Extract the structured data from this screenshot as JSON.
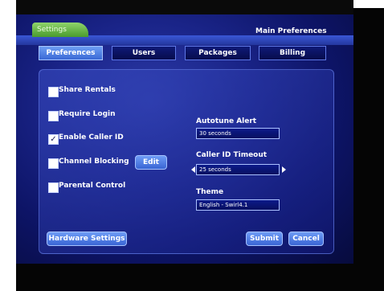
{
  "header": {
    "settings_tab": "Settings",
    "title": "Main Preferences"
  },
  "tabs": [
    {
      "label": "Preferences",
      "active": true
    },
    {
      "label": "Users",
      "active": false
    },
    {
      "label": "Packages",
      "active": false
    },
    {
      "label": "Billing",
      "active": false
    }
  ],
  "options": [
    {
      "label": "Share Rentals",
      "checked": false
    },
    {
      "label": "Require Login",
      "checked": false
    },
    {
      "label": "Enable Caller ID",
      "checked": true
    },
    {
      "label": "Channel Blocking",
      "checked": false
    },
    {
      "label": "Parental Control",
      "checked": false
    }
  ],
  "edit_button": "Edit",
  "autotune": {
    "label": "Autotune Alert",
    "value": "30 seconds"
  },
  "caller_id_timeout": {
    "label": "Caller ID Timeout",
    "value": "25 seconds"
  },
  "theme": {
    "label": "Theme",
    "value": "English - Swirl4.1"
  },
  "buttons": {
    "hardware": "Hardware Settings",
    "submit": "Submit",
    "cancel": "Cancel"
  },
  "colors": {
    "accent_green": "#6cbf45",
    "tab_active": "#4e82e6",
    "background": "#1a2488"
  }
}
